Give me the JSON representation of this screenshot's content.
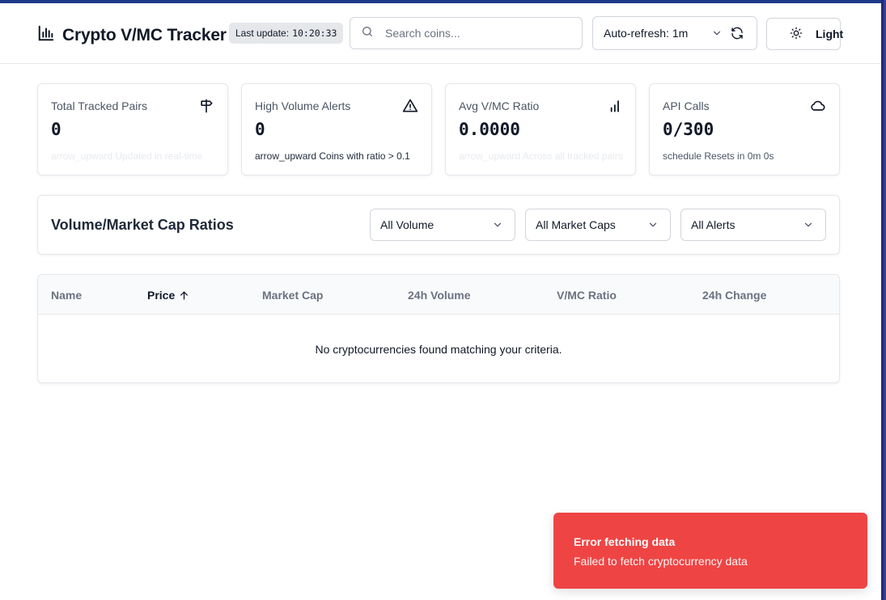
{
  "header": {
    "title": "Crypto V/MC Tracker",
    "logo_icon": "bar-chart-icon",
    "last_update_label": "Last update:",
    "last_update_time": "10:20:33",
    "search_placeholder": "Search coins...",
    "auto_refresh_label": "Auto-refresh: 1m",
    "theme_label": "Light"
  },
  "stats": [
    {
      "title": "Total Tracked Pairs",
      "value": "0",
      "subtitle": "arrow_upward Updated in real-time",
      "icon": "signpost-icon"
    },
    {
      "title": "High Volume Alerts",
      "value": "0",
      "subtitle": "arrow_upward Coins with ratio > 0.1",
      "icon": "alert-triangle-icon"
    },
    {
      "title": "Avg V/MC Ratio",
      "value": "0.0000",
      "subtitle": "arrow_upward Across all tracked pairs",
      "icon": "signal-bars-icon"
    },
    {
      "title": "API Calls",
      "value": "0/300",
      "subtitle": "schedule Resets in 0m 0s",
      "icon": "cloud-icon"
    }
  ],
  "filters": {
    "section_title": "Volume/Market Cap Ratios",
    "volume": "All Volume",
    "market_cap": "All Market Caps",
    "alerts": "All Alerts"
  },
  "table": {
    "columns": [
      "Name",
      "Price",
      "Market Cap",
      "24h Volume",
      "V/MC Ratio",
      "24h Change"
    ],
    "sorted_column": "Price",
    "sort_direction": "ascending",
    "empty_message": "No cryptocurrencies found matching your criteria."
  },
  "toast": {
    "title": "Error fetching data",
    "description": "Failed to fetch cryptocurrency data",
    "color": "#ef4444"
  },
  "colors": {
    "top_border": "#1e3a8a",
    "toast_error": "#ef4444"
  }
}
